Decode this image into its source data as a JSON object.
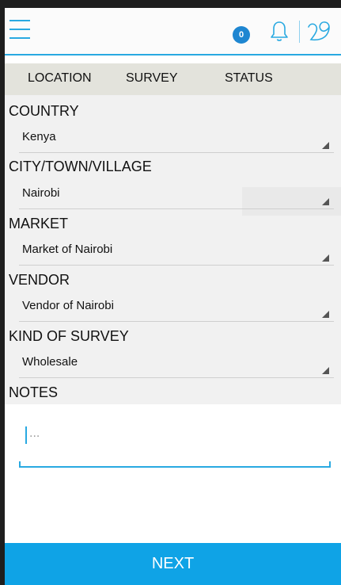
{
  "header": {
    "notification_count": "0",
    "accent_color": "#29a9e1",
    "icons": [
      "menu-icon",
      "bell-icon",
      "swirl-logo-icon"
    ]
  },
  "tabs": [
    {
      "label": "LOCATION"
    },
    {
      "label": "SURVEY"
    },
    {
      "label": "STATUS"
    }
  ],
  "form": {
    "country": {
      "label": "COUNTRY",
      "value": "Kenya"
    },
    "city": {
      "label": "CITY/TOWN/VILLAGE",
      "value": "Nairobi"
    },
    "market": {
      "label": "MARKET",
      "value": "Market of Nairobi"
    },
    "vendor": {
      "label": "VENDOR",
      "value": "Vendor of Nairobi"
    },
    "survey_kind": {
      "label": "KIND OF SURVEY",
      "value": "Wholesale"
    },
    "notes": {
      "label": "NOTES",
      "placeholder": "..."
    }
  },
  "footer": {
    "next_label": "NEXT",
    "next_color": "#0fa3e6"
  }
}
